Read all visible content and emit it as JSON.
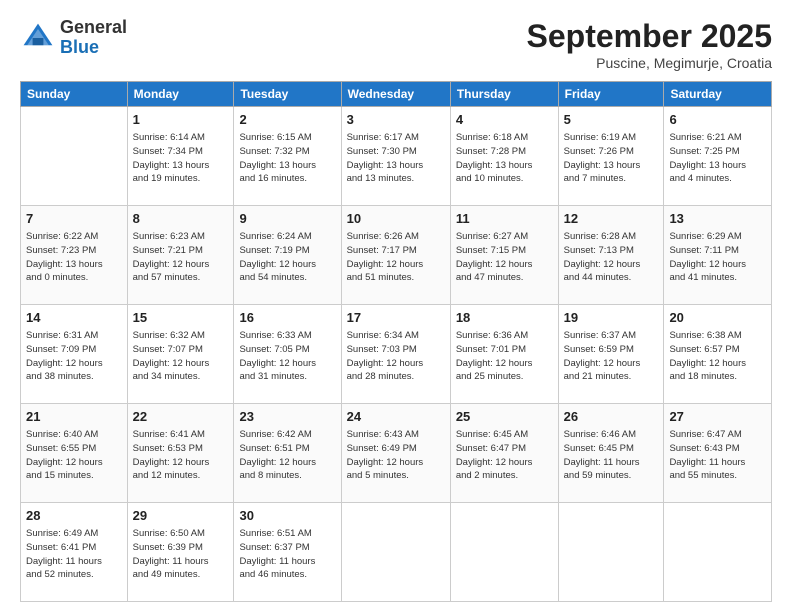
{
  "header": {
    "logo_general": "General",
    "logo_blue": "Blue",
    "month": "September 2025",
    "location": "Puscine, Megimurje, Croatia"
  },
  "weekdays": [
    "Sunday",
    "Monday",
    "Tuesday",
    "Wednesday",
    "Thursday",
    "Friday",
    "Saturday"
  ],
  "weeks": [
    [
      {
        "day": "",
        "info": ""
      },
      {
        "day": "1",
        "info": "Sunrise: 6:14 AM\nSunset: 7:34 PM\nDaylight: 13 hours\nand 19 minutes."
      },
      {
        "day": "2",
        "info": "Sunrise: 6:15 AM\nSunset: 7:32 PM\nDaylight: 13 hours\nand 16 minutes."
      },
      {
        "day": "3",
        "info": "Sunrise: 6:17 AM\nSunset: 7:30 PM\nDaylight: 13 hours\nand 13 minutes."
      },
      {
        "day": "4",
        "info": "Sunrise: 6:18 AM\nSunset: 7:28 PM\nDaylight: 13 hours\nand 10 minutes."
      },
      {
        "day": "5",
        "info": "Sunrise: 6:19 AM\nSunset: 7:26 PM\nDaylight: 13 hours\nand 7 minutes."
      },
      {
        "day": "6",
        "info": "Sunrise: 6:21 AM\nSunset: 7:25 PM\nDaylight: 13 hours\nand 4 minutes."
      }
    ],
    [
      {
        "day": "7",
        "info": "Sunrise: 6:22 AM\nSunset: 7:23 PM\nDaylight: 13 hours\nand 0 minutes."
      },
      {
        "day": "8",
        "info": "Sunrise: 6:23 AM\nSunset: 7:21 PM\nDaylight: 12 hours\nand 57 minutes."
      },
      {
        "day": "9",
        "info": "Sunrise: 6:24 AM\nSunset: 7:19 PM\nDaylight: 12 hours\nand 54 minutes."
      },
      {
        "day": "10",
        "info": "Sunrise: 6:26 AM\nSunset: 7:17 PM\nDaylight: 12 hours\nand 51 minutes."
      },
      {
        "day": "11",
        "info": "Sunrise: 6:27 AM\nSunset: 7:15 PM\nDaylight: 12 hours\nand 47 minutes."
      },
      {
        "day": "12",
        "info": "Sunrise: 6:28 AM\nSunset: 7:13 PM\nDaylight: 12 hours\nand 44 minutes."
      },
      {
        "day": "13",
        "info": "Sunrise: 6:29 AM\nSunset: 7:11 PM\nDaylight: 12 hours\nand 41 minutes."
      }
    ],
    [
      {
        "day": "14",
        "info": "Sunrise: 6:31 AM\nSunset: 7:09 PM\nDaylight: 12 hours\nand 38 minutes."
      },
      {
        "day": "15",
        "info": "Sunrise: 6:32 AM\nSunset: 7:07 PM\nDaylight: 12 hours\nand 34 minutes."
      },
      {
        "day": "16",
        "info": "Sunrise: 6:33 AM\nSunset: 7:05 PM\nDaylight: 12 hours\nand 31 minutes."
      },
      {
        "day": "17",
        "info": "Sunrise: 6:34 AM\nSunset: 7:03 PM\nDaylight: 12 hours\nand 28 minutes."
      },
      {
        "day": "18",
        "info": "Sunrise: 6:36 AM\nSunset: 7:01 PM\nDaylight: 12 hours\nand 25 minutes."
      },
      {
        "day": "19",
        "info": "Sunrise: 6:37 AM\nSunset: 6:59 PM\nDaylight: 12 hours\nand 21 minutes."
      },
      {
        "day": "20",
        "info": "Sunrise: 6:38 AM\nSunset: 6:57 PM\nDaylight: 12 hours\nand 18 minutes."
      }
    ],
    [
      {
        "day": "21",
        "info": "Sunrise: 6:40 AM\nSunset: 6:55 PM\nDaylight: 12 hours\nand 15 minutes."
      },
      {
        "day": "22",
        "info": "Sunrise: 6:41 AM\nSunset: 6:53 PM\nDaylight: 12 hours\nand 12 minutes."
      },
      {
        "day": "23",
        "info": "Sunrise: 6:42 AM\nSunset: 6:51 PM\nDaylight: 12 hours\nand 8 minutes."
      },
      {
        "day": "24",
        "info": "Sunrise: 6:43 AM\nSunset: 6:49 PM\nDaylight: 12 hours\nand 5 minutes."
      },
      {
        "day": "25",
        "info": "Sunrise: 6:45 AM\nSunset: 6:47 PM\nDaylight: 12 hours\nand 2 minutes."
      },
      {
        "day": "26",
        "info": "Sunrise: 6:46 AM\nSunset: 6:45 PM\nDaylight: 11 hours\nand 59 minutes."
      },
      {
        "day": "27",
        "info": "Sunrise: 6:47 AM\nSunset: 6:43 PM\nDaylight: 11 hours\nand 55 minutes."
      }
    ],
    [
      {
        "day": "28",
        "info": "Sunrise: 6:49 AM\nSunset: 6:41 PM\nDaylight: 11 hours\nand 52 minutes."
      },
      {
        "day": "29",
        "info": "Sunrise: 6:50 AM\nSunset: 6:39 PM\nDaylight: 11 hours\nand 49 minutes."
      },
      {
        "day": "30",
        "info": "Sunrise: 6:51 AM\nSunset: 6:37 PM\nDaylight: 11 hours\nand 46 minutes."
      },
      {
        "day": "",
        "info": ""
      },
      {
        "day": "",
        "info": ""
      },
      {
        "day": "",
        "info": ""
      },
      {
        "day": "",
        "info": ""
      }
    ]
  ]
}
